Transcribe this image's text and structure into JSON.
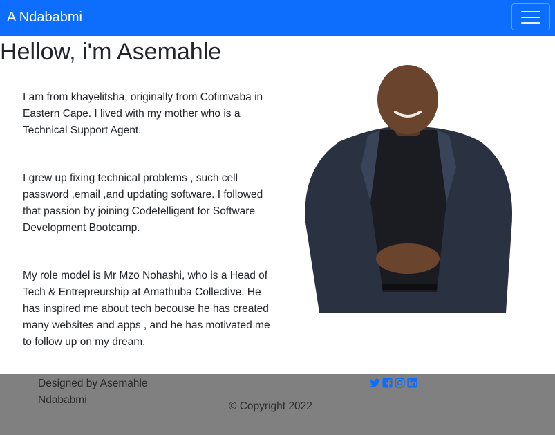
{
  "navbar": {
    "brand": "A Ndababmi",
    "toggle_icon": "hamburger-menu-icon",
    "color": "#0d6efd"
  },
  "main": {
    "title": "Hellow, i'm Asemahle",
    "paragraphs": [
      "I am from khayelitsha, originally from Cofimvaba in Eastern Cape. I lived with my mother who is a Technical Support Agent.",
      "I grew up fixing technical problems , such cell password ,email ,and updating software. I followed that passion by joining Codetelligent for Software Development Bootcamp.",
      "My role model is Mr Mzo Nohashi, who is a Head of Tech & Entrepreurship at Amathuba Collective. He has inspired me about tech becouse he has created many websites and apps , and he has motivated me to follow up on my dream."
    ],
    "portrait_icon": "person-photo"
  },
  "footer": {
    "credit": "Designed by Asemahle Ndababmi",
    "copyright": "© Copyright 2022",
    "background": "#808080",
    "social_icons": [
      "twitter-icon",
      "facebook-icon",
      "instagram-icon",
      "linkedin-icon"
    ],
    "social_color": "#0d6efd"
  }
}
